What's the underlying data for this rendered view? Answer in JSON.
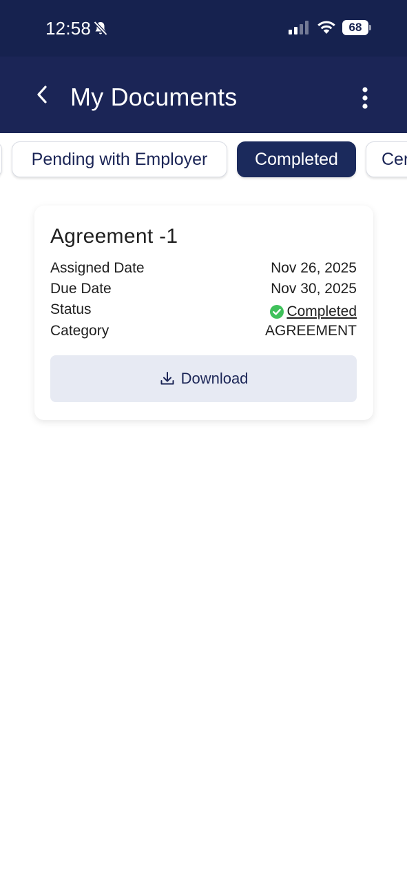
{
  "status_bar": {
    "time": "12:58",
    "battery": "68"
  },
  "header": {
    "title": "My Documents",
    "back_icon": "chevron-left-icon",
    "menu_icon": "more-vertical-icon",
    "background": "#1b2556"
  },
  "tabs": [
    {
      "label": "Pending with Employer",
      "active": false
    },
    {
      "label": "Completed",
      "active": true
    },
    {
      "label": "Cer",
      "active": false
    }
  ],
  "document": {
    "title": "Agreement -1",
    "rows": {
      "assigned_label": "Assigned Date",
      "assigned_value": "Nov 26, 2025",
      "due_label": "Due Date",
      "due_value": "Nov 30, 2025",
      "status_label": "Status",
      "status_value": "Completed",
      "category_label": "Category",
      "category_value": "AGREEMENT"
    },
    "status_color": "#3fc15b",
    "download_label": "Download",
    "download_icon": "download-icon"
  }
}
